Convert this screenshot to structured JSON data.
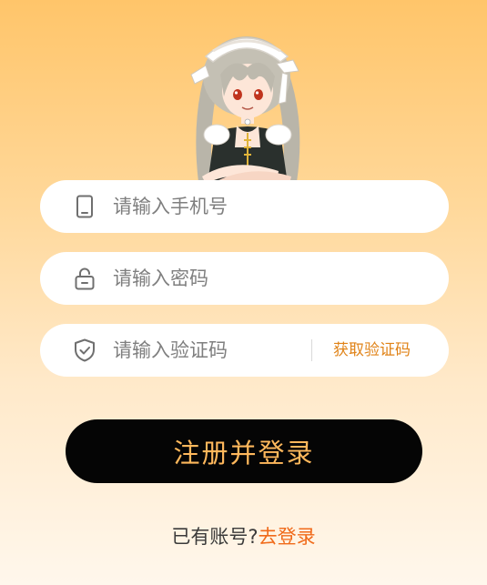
{
  "mascot": {
    "description_icon": "maid-mascot-illustration"
  },
  "form": {
    "phone": {
      "placeholder": "请输入手机号",
      "icon": "phone-icon"
    },
    "password": {
      "placeholder": "请输入密码",
      "icon": "lock-icon"
    },
    "code": {
      "placeholder": "请输入验证码",
      "icon": "shield-check-icon",
      "get_code_label": "获取验证码"
    },
    "submit_label": "注册并登录"
  },
  "footer": {
    "prompt": "已有账号?",
    "login_link": "去登录"
  },
  "colors": {
    "accent_orange": "#e08318",
    "link_orange": "#f06a1a",
    "button_bg": "#050505",
    "button_text": "#ffb85c"
  }
}
